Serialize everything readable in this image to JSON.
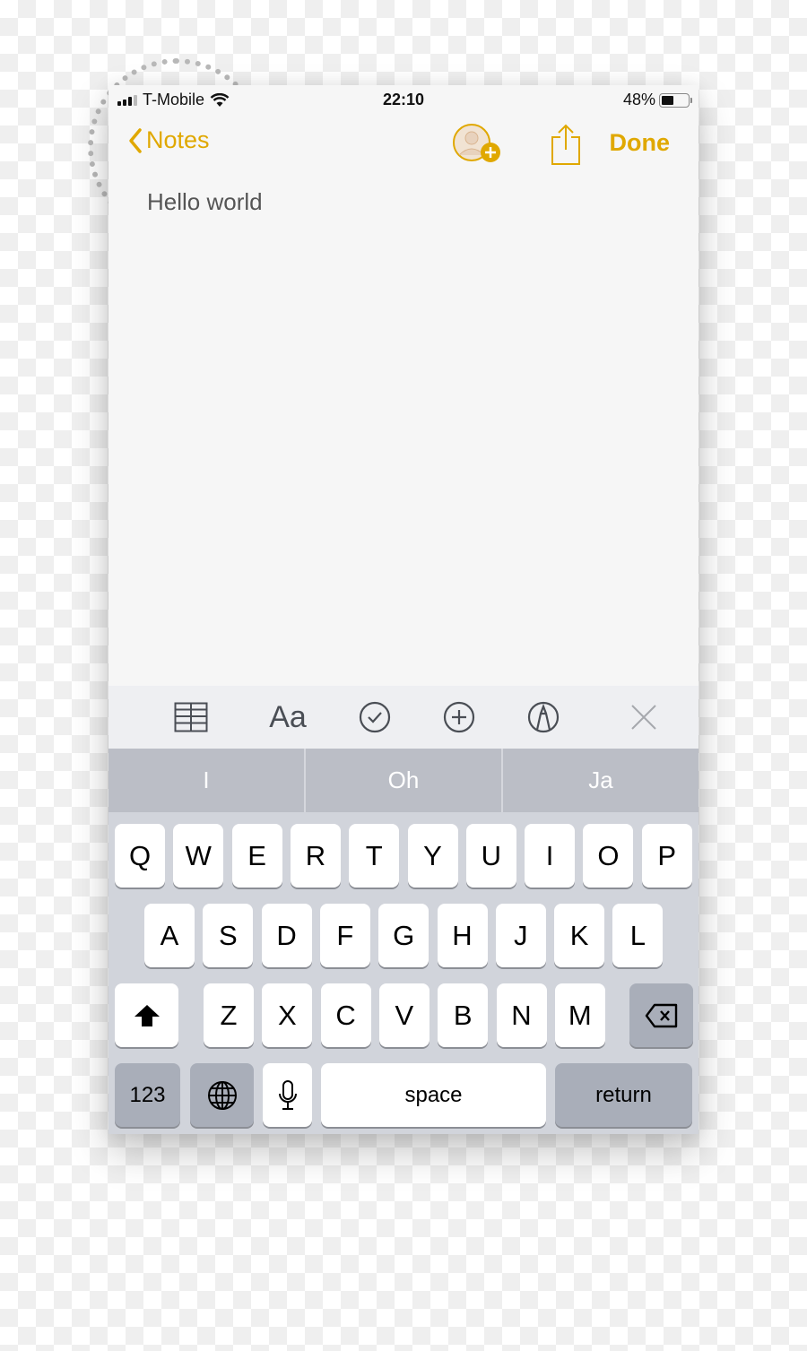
{
  "status_bar": {
    "carrier": "T-Mobile",
    "time": "22:10",
    "battery_percent_label": "48%",
    "battery_level": 0.48,
    "signal_bars": 3,
    "signal_max": 4
  },
  "nav": {
    "back_label": "Notes",
    "done_label": "Done",
    "accent_color": "#e0a800",
    "icons": [
      "chevron-left-icon",
      "add-person-icon",
      "share-icon"
    ]
  },
  "note": {
    "text": "Hello world"
  },
  "toolbar": {
    "items": [
      {
        "name": "table-icon"
      },
      {
        "name": "text-format",
        "label": "Aa"
      },
      {
        "name": "checklist-icon"
      },
      {
        "name": "add-icon"
      },
      {
        "name": "sketch-icon"
      },
      {
        "name": "close-icon"
      }
    ]
  },
  "suggestions": [
    "I",
    "Oh",
    "Ja"
  ],
  "keyboard": {
    "row1": [
      "Q",
      "W",
      "E",
      "R",
      "T",
      "Y",
      "U",
      "I",
      "O",
      "P"
    ],
    "row2": [
      "A",
      "S",
      "D",
      "F",
      "G",
      "H",
      "J",
      "K",
      "L"
    ],
    "row3": [
      "Z",
      "X",
      "C",
      "V",
      "B",
      "N",
      "M"
    ],
    "numbers_label": "123",
    "space_label": "space",
    "return_label": "return"
  }
}
